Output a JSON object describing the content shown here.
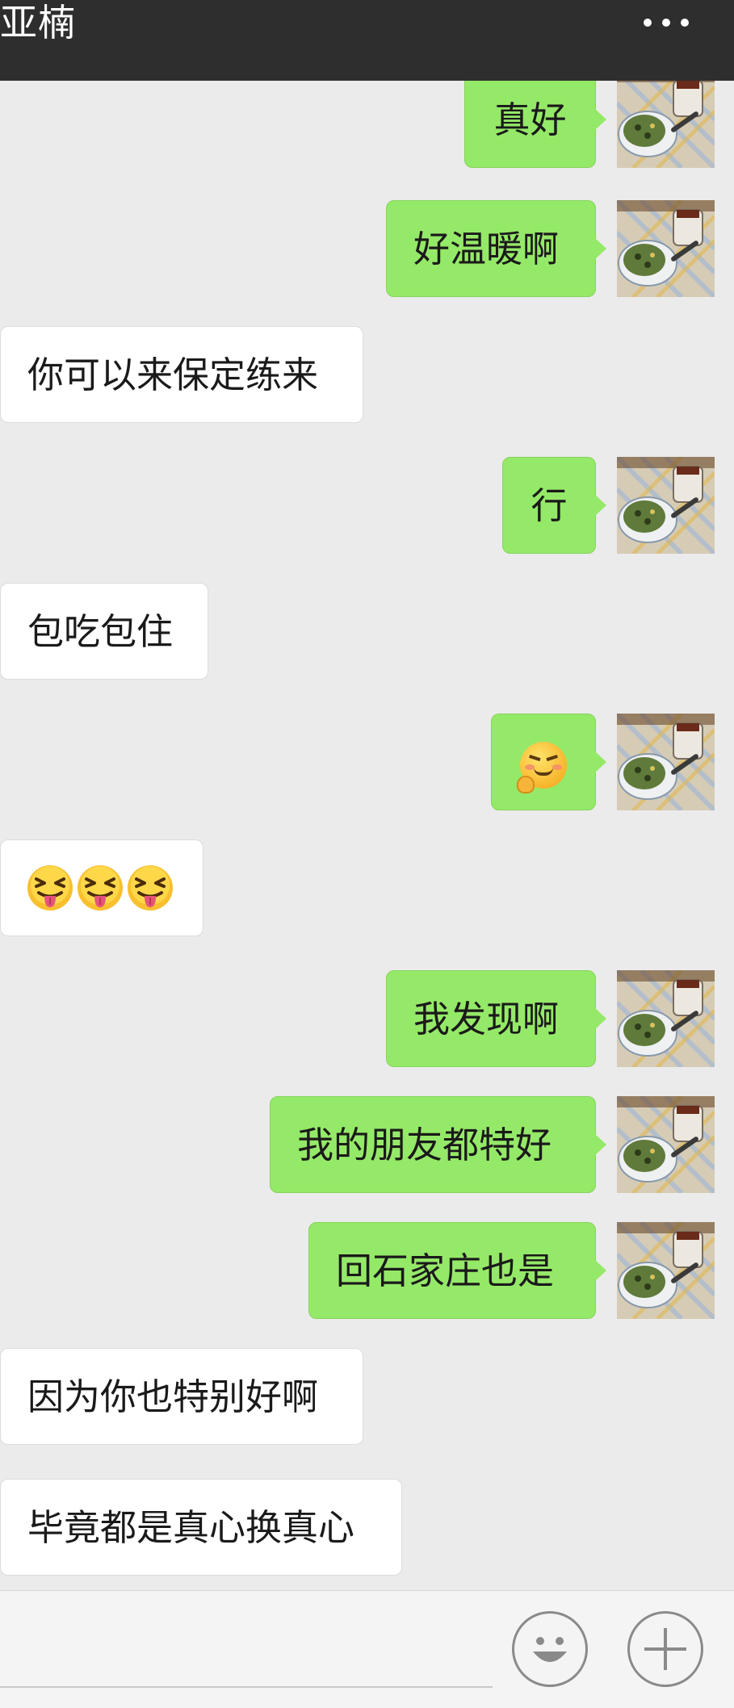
{
  "header": {
    "title": "亚楠"
  },
  "messages": [
    {
      "direction": "out",
      "text": "真好"
    },
    {
      "direction": "out",
      "text": "好温暖啊"
    },
    {
      "direction": "in",
      "text": "你可以来保定练来"
    },
    {
      "direction": "out",
      "text": "行"
    },
    {
      "direction": "in",
      "text": "包吃包住"
    },
    {
      "direction": "out",
      "text": "",
      "emoji": [
        "shy-giggle-face-emoji"
      ]
    },
    {
      "direction": "in",
      "text": "",
      "emoji": [
        "squinting-tongue-face-emoji",
        "squinting-tongue-face-emoji",
        "squinting-tongue-face-emoji"
      ]
    },
    {
      "direction": "out",
      "text": "我发现啊"
    },
    {
      "direction": "out",
      "text": "我的朋友都特好"
    },
    {
      "direction": "out",
      "text": "回石家庄也是"
    },
    {
      "direction": "in",
      "text": "因为你也特别好啊"
    },
    {
      "direction": "in",
      "text": "毕竟都是真心换真心"
    }
  ],
  "input_bar": {
    "icons": [
      "smiley-icon",
      "plus-icon"
    ]
  },
  "colors": {
    "header_bg": "#2e2e2e",
    "chat_bg": "#ebebeb",
    "outgoing_bubble": "#95e968",
    "incoming_bubble": "#ffffff"
  }
}
